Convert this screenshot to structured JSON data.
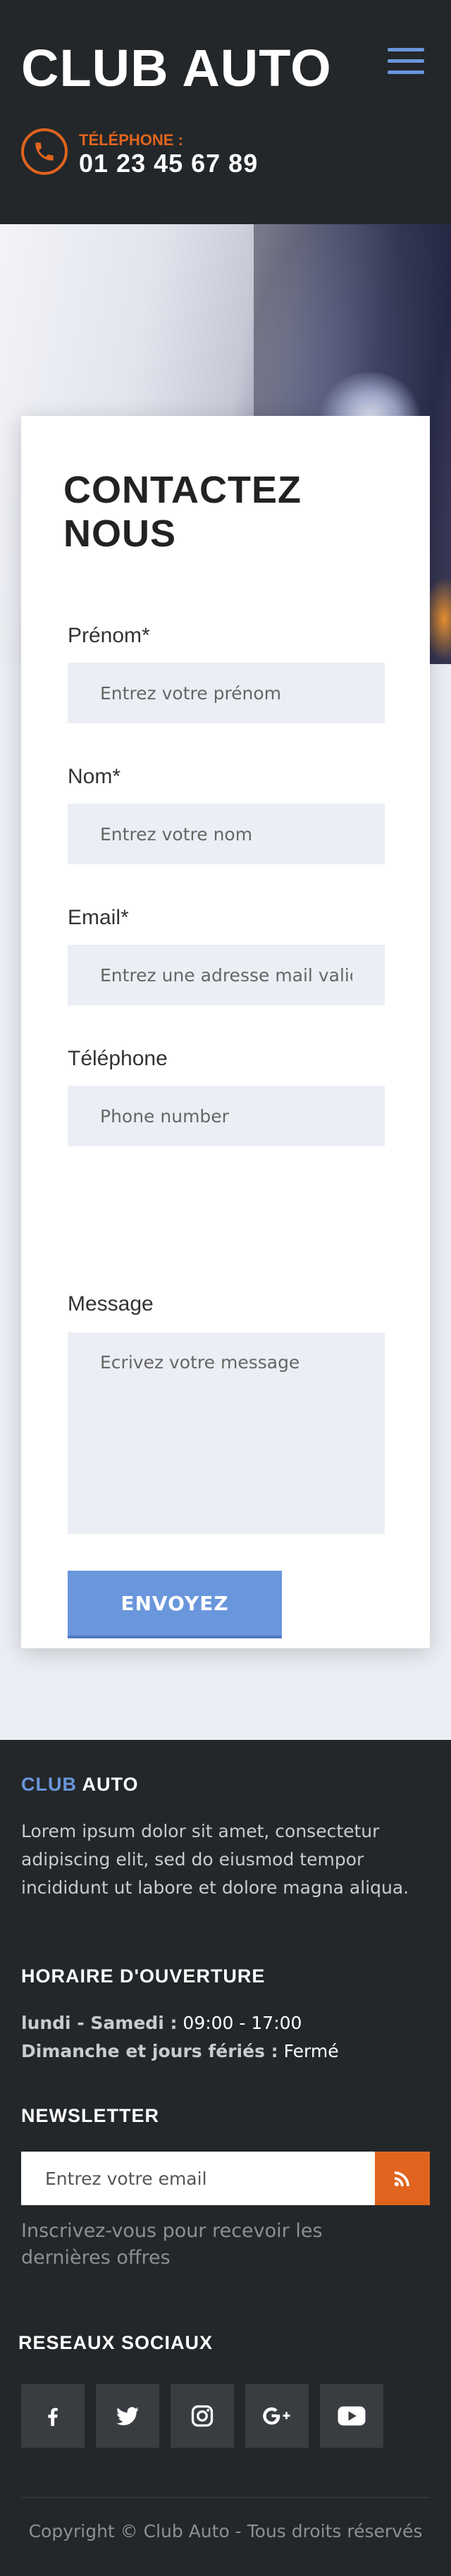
{
  "header": {
    "brand": "CLUB AUTO",
    "phone_label": "TÉLÉPHONE :",
    "phone_number": "01 23 45 67 89",
    "menu_icon": "hamburger-menu-icon",
    "phone_icon": "phone-icon"
  },
  "contact": {
    "title": "CONTACTEZ NOUS",
    "fields": {
      "firstname": {
        "label": "Prénom*",
        "placeholder": "Entrez votre prénom"
      },
      "lastname": {
        "label": "Nom*",
        "placeholder": "Entrez votre nom"
      },
      "email": {
        "label": "Email*",
        "placeholder": "Entrez une adresse mail valide"
      },
      "phone": {
        "label": "Téléphone",
        "placeholder": "Phone number"
      },
      "message": {
        "label": "Message",
        "placeholder": "Ecrivez votre message"
      }
    },
    "submit_label": "ENVOYEZ"
  },
  "footer": {
    "about": {
      "title_accent": "CLUB",
      "title_rest": " AUTO",
      "text": "Lorem ipsum dolor sit amet, consectetur adipiscing elit, sed do eiusmod tempor incididunt ut labore et dolore magna aliqua."
    },
    "hours": {
      "title": "HORAIRE D'OUVERTURE",
      "weekdays_label": "lundi - Samedi :",
      "weekdays_value": " 09:00 - 17:00",
      "holidays_label": "Dimanche et jours fériés :",
      "holidays_value": " Fermé"
    },
    "newsletter": {
      "title": "NEWSLETTER",
      "placeholder": "Entrez votre email",
      "button_icon": "rss-icon",
      "help": "Inscrivez-vous pour recevoir les dernières offres"
    },
    "social": {
      "title": "RESEAUX SOCIAUX",
      "items": [
        "facebook-icon",
        "twitter-icon",
        "instagram-icon",
        "google-plus-icon",
        "youtube-icon"
      ]
    },
    "copyright": "Copyright © Club Auto - Tous droits réservés"
  },
  "colors": {
    "dark": "#23272a",
    "accent_blue": "#6a96dc",
    "accent_orange": "#e0641e",
    "light_bg": "#ebeef4"
  }
}
